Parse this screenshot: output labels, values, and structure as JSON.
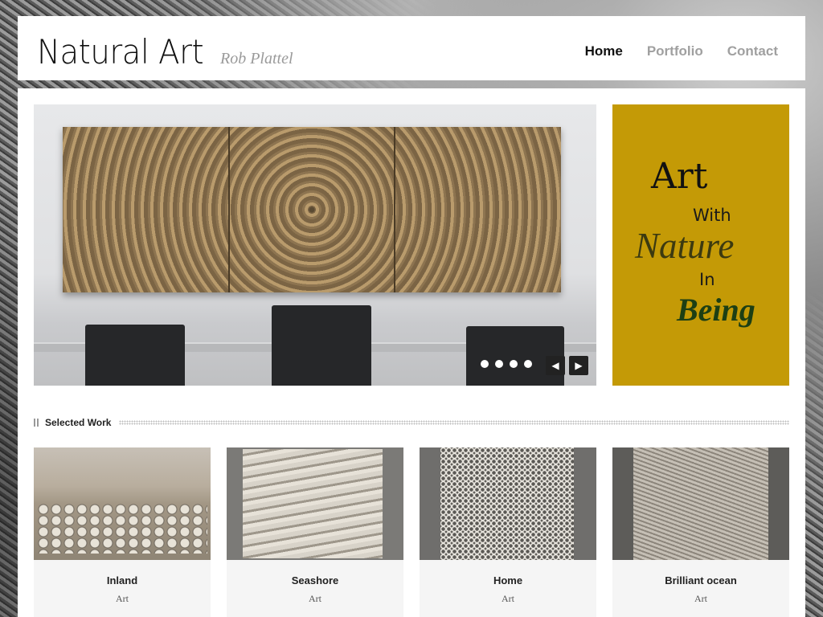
{
  "header": {
    "logo": "Natural Art",
    "tagline": "Rob Plattel",
    "nav": [
      {
        "label": "Home",
        "active": true
      },
      {
        "label": "Portfolio",
        "active": false
      },
      {
        "label": "Contact",
        "active": false
      }
    ]
  },
  "slider": {
    "slide_count": 4,
    "prev_icon": "chevron-left-icon",
    "next_icon": "chevron-right-icon"
  },
  "quote": {
    "line1": "Art",
    "line2": "With",
    "line3": "Nature",
    "line4": "In",
    "line5": "Being",
    "background": "#c49a06"
  },
  "section": {
    "title": "Selected Work"
  },
  "works": [
    {
      "title": "Inland",
      "category": "Art"
    },
    {
      "title": "Seashore",
      "category": "Art"
    },
    {
      "title": "Home",
      "category": "Art"
    },
    {
      "title": "Brilliant ocean",
      "category": "Art"
    }
  ]
}
